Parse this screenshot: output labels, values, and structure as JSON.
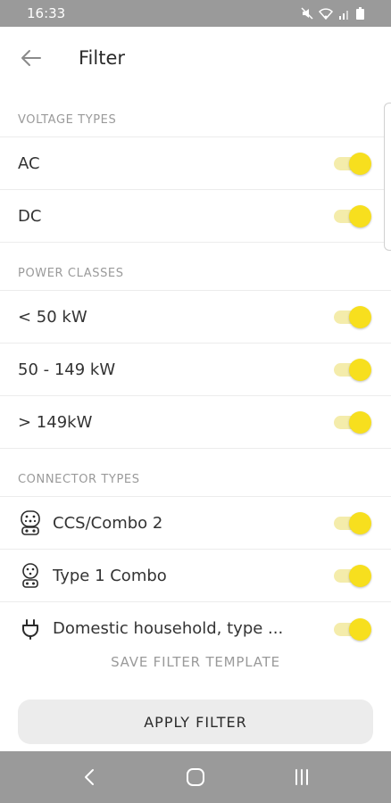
{
  "status_bar": {
    "time": "16:33"
  },
  "header": {
    "title": "Filter"
  },
  "sections": {
    "voltage": {
      "label": "VOLTAGE TYPES",
      "items": [
        {
          "label": "AC",
          "on": true
        },
        {
          "label": "DC",
          "on": true
        }
      ]
    },
    "power": {
      "label": "POWER CLASSES",
      "items": [
        {
          "label": "< 50 kW",
          "on": true
        },
        {
          "label": "50 - 149 kW",
          "on": true
        },
        {
          "label": "> 149kW",
          "on": true
        }
      ]
    },
    "connector": {
      "label": "CONNECTOR TYPES",
      "items": [
        {
          "label": "CCS/Combo 2",
          "icon": "ccs-combo-2-connector-icon",
          "on": true
        },
        {
          "label": "Type 1 Combo",
          "icon": "type-1-combo-connector-icon",
          "on": true
        },
        {
          "label": "Domestic household, type ...",
          "icon": "plug-icon",
          "on": true
        }
      ]
    }
  },
  "actions": {
    "save_template": "SAVE FILTER TEMPLATE",
    "apply": "APPLY FILTER"
  },
  "colors": {
    "accent": "#f7df1e",
    "accent_track": "#f4ecab",
    "system_bar": "#9a9a9a",
    "divider": "#ececec"
  }
}
